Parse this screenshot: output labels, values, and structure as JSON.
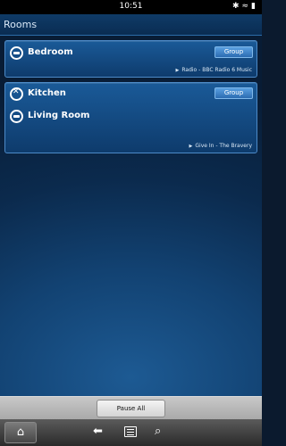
{
  "status_bar": {
    "time": "10:51",
    "icons": [
      "gear-icon",
      "wifi-icon",
      "battery-icon"
    ]
  },
  "header": {
    "title": "Rooms"
  },
  "rooms": [
    {
      "name": "Bedroom",
      "icon": "speaker-icon",
      "group_label": "Group",
      "now_playing": "Radio - BBC Radio 6 Music"
    },
    {
      "name": "Kitchen",
      "icon": "utensils-icon",
      "group_label": "Group",
      "now_playing": ""
    },
    {
      "name": "Living Room",
      "icon": "speaker-icon",
      "group_label": "",
      "now_playing": "Give In - The Bravery"
    }
  ],
  "bottom": {
    "pause_all_label": "Pause All"
  },
  "nav": {
    "items": [
      "home-icon",
      "back-icon",
      "menu-icon",
      "search-icon"
    ]
  },
  "colors": {
    "accent": "#1a5a98",
    "card_border": "#4d8bc9",
    "group_button": "#3f84cb"
  }
}
